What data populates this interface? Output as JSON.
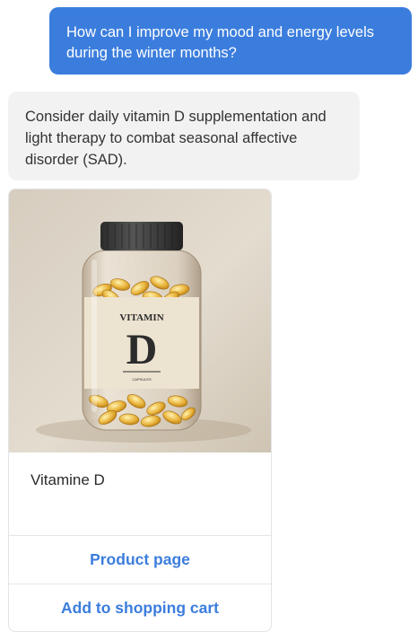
{
  "chat": {
    "user_message": "How can I improve my mood and energy levels during the winter months?",
    "bot_message": "Consider daily vitamin D supplementation and light therapy to combat seasonal affective disorder (SAD)."
  },
  "product_card": {
    "image_icon": "vitamin-d-bottle-photo",
    "image_label_top": "VITAMIN",
    "image_label_letter": "D",
    "image_label_small": "CAPSULES",
    "name": "Vitamine D",
    "actions": [
      {
        "label": "Product page"
      },
      {
        "label": "Add to shopping cart"
      }
    ]
  },
  "colors": {
    "accent": "#3b7ddd",
    "bot_bubble_bg": "#f2f2f3",
    "card_border": "#e3e4e6"
  }
}
